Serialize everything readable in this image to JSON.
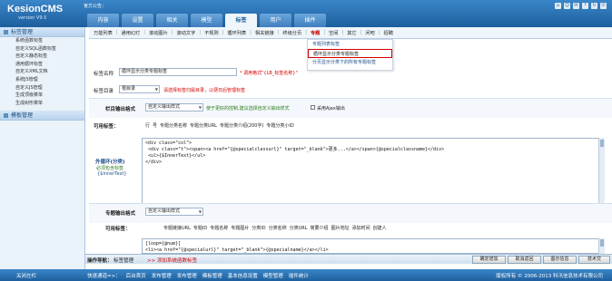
{
  "header": {
    "logo": "KesionCMS",
    "version": "version V9.5",
    "announcement": "官方公告：",
    "tabs": [
      "内容",
      "设置",
      "相关",
      "模型",
      "标签",
      "用户",
      "插件"
    ],
    "active_tab": "标签"
  },
  "sidebar": {
    "section1_title": "标签管理",
    "items": [
      "系统函数标签",
      "自定义SQL函数标签",
      "自定义静态标签",
      "通用循环标签",
      "自定义XML文档",
      "系统JS管理",
      "自定义JS管理",
      "生成顶级菜单",
      "生成树形菜单"
    ],
    "section2_title": "模板管理"
  },
  "subnav": {
    "items": [
      "万能列表",
      "通用幻灯",
      "滚动图片",
      "滚动文字",
      "不规则",
      "循环列表",
      "相关链接",
      "终级分页",
      "专题",
      "空间",
      "其它",
      "问吧",
      "招聘"
    ],
    "active": "专题"
  },
  "dropdown": {
    "items": [
      "专题列表标签",
      "循环显示分类专题标签",
      "分页显示分类下的所有专题标签"
    ],
    "highlighted": "循环显示分类专题标签"
  },
  "form": {
    "name_label": "标签名称",
    "name_value": "循环显示分类专题标签",
    "name_note": "* 调用格式\"{LB_标签名称}\"",
    "dir_label": "标签目录",
    "dir_value": "根目录",
    "dir_note": "请选择标签归属目录，以便日后管理标签",
    "outer_label": "栏目输出格式",
    "outer_select": "自定义输出样式",
    "outer_note": "使于更好的控制,建议选择自定义输出样式",
    "ajax_label": "采用Ajax输出",
    "avail_label": "可用标签：",
    "avail_tags1": [
      "行",
      "号",
      "专题分类名称",
      "专题分类URL",
      "专题分类介绍(200字)",
      "专题分类小ID"
    ],
    "loop_label": "外循环(分类)",
    "loop_note1": "必须包含标签",
    "loop_note2": "{$InnerText}",
    "code1": "<div class=\"col\">\n <div class=\"t\"><span><a href=\"{@specialclassurl}\" target=\"_blank\">更多...</a></span>{@specialclassname}</div>\n <ul>{$InnerText}</ul>\n</div>",
    "inner_label": "专题输出格式",
    "inner_select": "自定义输出样式",
    "avail_label2": "可用标签：",
    "avail_tags2": [
      "专题链接URL",
      "专题ID",
      "专题名称",
      "专题图片",
      "分类ID",
      "分类名称",
      "分类URL",
      "简要介绍",
      "图片地址",
      "添加时间",
      "创建人"
    ],
    "code2": "[loop={@num}]\n<li><a href=\"{@specialurl}\" target=\"_blank\">{@specialname}</a></li>\n[/loop]"
  },
  "action_bar": {
    "crumb_label": "操作导航：",
    "crumb_value": "标签管理",
    "crumb_link": ">> 添加系统函数标签",
    "buttons": [
      "确定增加",
      "取消返回",
      "图示信息",
      "技术交"
    ]
  },
  "footer": {
    "toggle": "关闭左栏",
    "quick": [
      "快速通道=>：",
      "后台首页",
      "发布管理",
      "发布管理",
      "模板管理",
      "基本信息设置",
      "模型管理",
      "插件统计"
    ],
    "copyright": "版权所有 © 2006-2013 科汛信息技术有限公司"
  }
}
